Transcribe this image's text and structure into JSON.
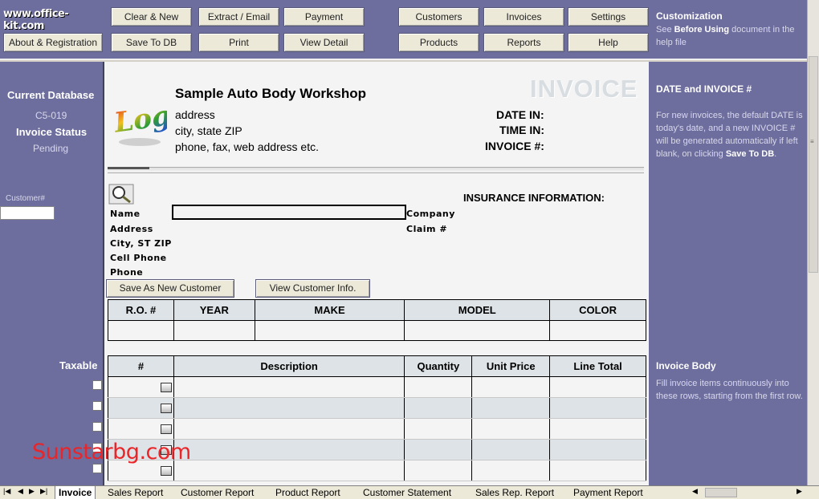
{
  "brand": {
    "site": "www.office-kit.com"
  },
  "toolbar": {
    "about": "About & Registration",
    "clear_new": "Clear & New",
    "save_db": "Save To DB",
    "extract_email": "Extract / Email",
    "print": "Print",
    "payment": "Payment",
    "view_detail": "View Detail",
    "customers": "Customers",
    "products": "Products",
    "invoices": "Invoices",
    "reports": "Reports",
    "settings": "Settings",
    "help": "Help"
  },
  "customization": {
    "title": "Customization",
    "pre": "See ",
    "bold": "Before Using",
    "post": " document in the help file"
  },
  "left": {
    "current_db_label": "Current Database",
    "current_db_value": "C5-019",
    "status_label": "Invoice Status",
    "status_value": "Pending",
    "customer_label": "Customer#",
    "customer_value": "",
    "taxable": "Taxable"
  },
  "right": {
    "date_title": "DATE and INVOICE #",
    "date_text_a": "For new invoices, the default DATE is today's date, and a new INVOICE # will be generated automatically if left blank, on clicking ",
    "date_text_bold": "Save To DB",
    "date_text_c": ".",
    "body_title": "Invoice Body",
    "body_text": "Fill invoice items continuously into these rows, starting from the first row."
  },
  "invoice": {
    "logo_text": "Logo",
    "company": "Sample Auto Body Workshop",
    "address": "address",
    "city": "city, state ZIP",
    "contact": "phone, fax, web address etc.",
    "heading": "INVOICE",
    "date_in": "DATE IN:",
    "time_in": "TIME IN:",
    "invoice_no": "INVOICE #:",
    "insurance_title": "INSURANCE INFORMATION:",
    "company_label": "Company",
    "claim_label": "Claim #",
    "name_label": "Name",
    "address_label": "Address",
    "city_label": "City, ST ZIP",
    "cell_label": "Cell Phone",
    "phone_label": "Phone",
    "save_customer": "Save As New Customer",
    "view_customer": "View Customer Info."
  },
  "vehicle": {
    "headers": [
      "R.O. #",
      "YEAR",
      "MAKE",
      "MODEL",
      "COLOR"
    ]
  },
  "items": {
    "headers": [
      "#",
      "Description",
      "Quantity",
      "Unit Price",
      "Line Total"
    ]
  },
  "watermark": "Sunstarbg.com",
  "tabs": [
    "Invoice",
    "Sales Report",
    "Customer Report",
    "Product Report",
    "Customer Statement",
    "Sales Rep. Report",
    "Payment Report"
  ],
  "colors": {
    "sidebar": "#6d6d9e",
    "header_fill": "#dde3e6",
    "watermark": "#e8262a"
  }
}
